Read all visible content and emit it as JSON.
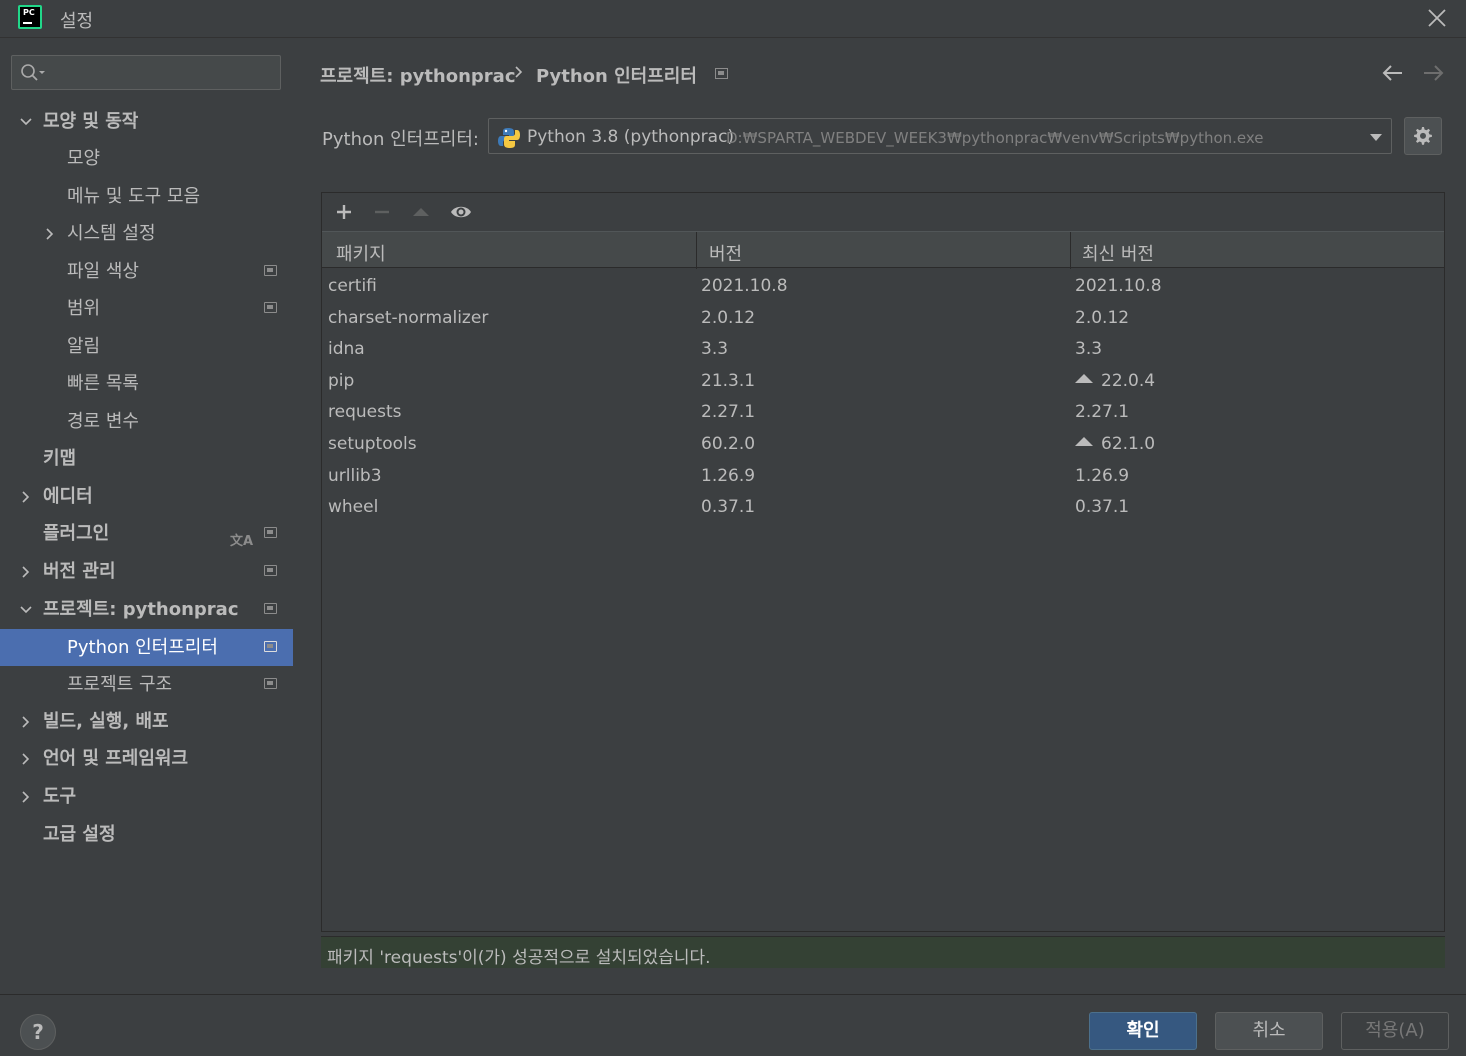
{
  "window": {
    "title": "설정",
    "app_icon_text": "PC"
  },
  "sidebar": {
    "search": {
      "value": "",
      "placeholder": ""
    },
    "items": [
      {
        "label": "모양 및 동작",
        "bold": true,
        "expanded": true
      },
      {
        "label": "모양"
      },
      {
        "label": "메뉴 및 도구 모음"
      },
      {
        "label": "시스템 설정",
        "collapsed": true
      },
      {
        "label": "파일 색상"
      },
      {
        "label": "범위"
      },
      {
        "label": "알림"
      },
      {
        "label": "빠른 목록"
      },
      {
        "label": "경로 변수"
      },
      {
        "label": "키맵",
        "bold": true
      },
      {
        "label": "에디터",
        "bold": true,
        "collapsed": true
      },
      {
        "label": "플러그인",
        "bold": true
      },
      {
        "label": "버전 관리",
        "bold": true,
        "collapsed": true
      },
      {
        "label": "프로젝트: pythonprac",
        "bold": true,
        "expanded": true
      },
      {
        "label": "Python 인터프리터",
        "selected": true
      },
      {
        "label": "프로젝트 구조"
      },
      {
        "label": "빌드, 실행, 배포",
        "bold": true,
        "collapsed": true
      },
      {
        "label": "언어 및 프레임워크",
        "bold": true,
        "collapsed": true
      },
      {
        "label": "도구",
        "bold": true,
        "collapsed": true
      },
      {
        "label": "고급 설정",
        "bold": true
      }
    ]
  },
  "breadcrumb": {
    "project": "프로젝트: pythonprac",
    "page": "Python 인터프리터"
  },
  "interpreter": {
    "label": "Python 인터프리터:",
    "name": "Python 3.8 (pythonprac)",
    "path": "D:₩SPARTA_WEBDEV_WEEK3₩pythonprac₩venv₩Scripts₩python.exe"
  },
  "packages": {
    "headers": [
      "패키지",
      "버전",
      "최신 버전"
    ],
    "rows": [
      {
        "name": "certifi",
        "version": "2021.10.8",
        "latest": "2021.10.8",
        "upgrade": false
      },
      {
        "name": "charset-normalizer",
        "version": "2.0.12",
        "latest": "2.0.12",
        "upgrade": false
      },
      {
        "name": "idna",
        "version": "3.3",
        "latest": "3.3",
        "upgrade": false
      },
      {
        "name": "pip",
        "version": "21.3.1",
        "latest": "22.0.4",
        "upgrade": true
      },
      {
        "name": "requests",
        "version": "2.27.1",
        "latest": "2.27.1",
        "upgrade": false
      },
      {
        "name": "setuptools",
        "version": "60.2.0",
        "latest": "62.1.0",
        "upgrade": true
      },
      {
        "name": "urllib3",
        "version": "1.26.9",
        "latest": "1.26.9",
        "upgrade": false
      },
      {
        "name": "wheel",
        "version": "0.37.1",
        "latest": "0.37.1",
        "upgrade": false
      }
    ]
  },
  "status": {
    "message": "패키지 'requests'이(가) 성공적으로 설치되었습니다."
  },
  "footer": {
    "help_label": "?",
    "ok_label": "확인",
    "cancel_label": "취소",
    "apply_label": "적용(A)"
  },
  "colors": {
    "background": "#3c3f41",
    "selection": "#4b6eaf",
    "status_bg": "#344134",
    "primary_button": "#365880"
  }
}
